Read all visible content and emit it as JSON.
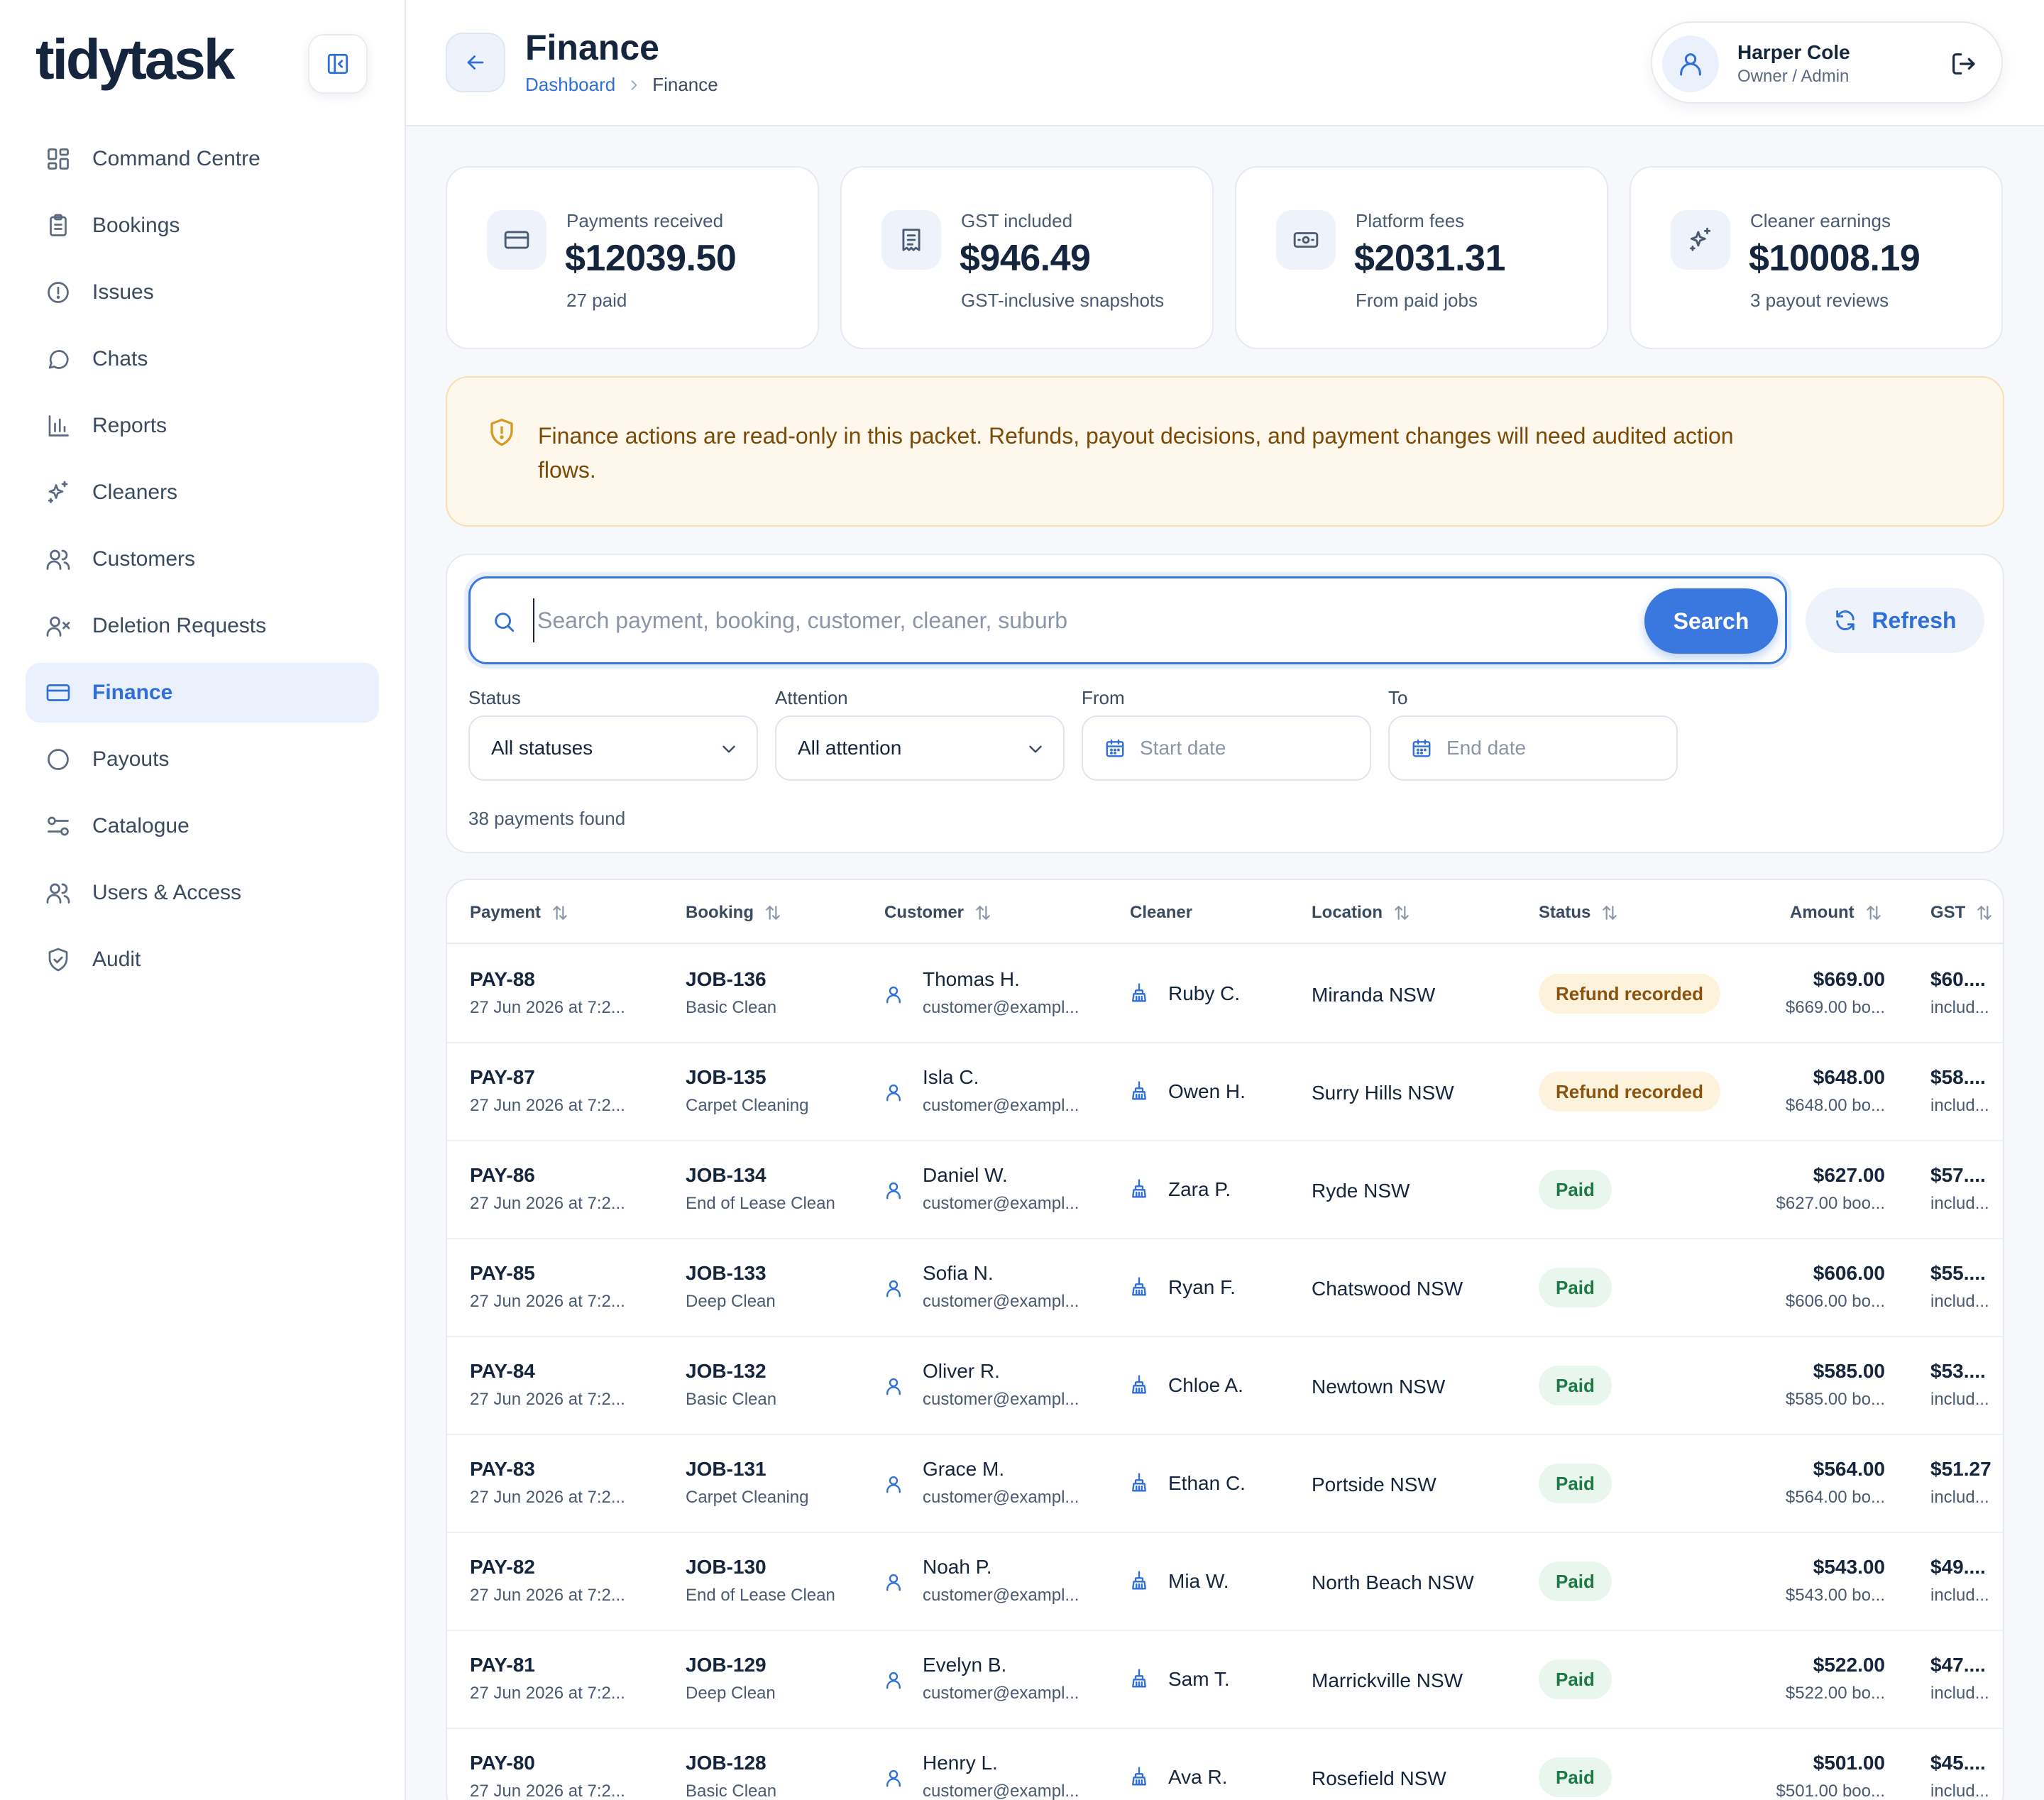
{
  "app": {
    "logo": "tidytask"
  },
  "sidebar": {
    "items": [
      {
        "label": "Command Centre",
        "icon": "grid-icon"
      },
      {
        "label": "Bookings",
        "icon": "clipboard-icon"
      },
      {
        "label": "Issues",
        "icon": "alert-circle-icon"
      },
      {
        "label": "Chats",
        "icon": "chat-bubble-icon"
      },
      {
        "label": "Reports",
        "icon": "bar-chart-icon"
      },
      {
        "label": "Cleaners",
        "icon": "sparkles-icon"
      },
      {
        "label": "Customers",
        "icon": "users-icon"
      },
      {
        "label": "Deletion Requests",
        "icon": "user-x-icon"
      },
      {
        "label": "Finance",
        "icon": "credit-card-icon",
        "active": true
      },
      {
        "label": "Payouts",
        "icon": "circle-icon"
      },
      {
        "label": "Catalogue",
        "icon": "sliders-icon"
      },
      {
        "label": "Users & Access",
        "icon": "users-icon"
      },
      {
        "label": "Audit",
        "icon": "shield-check-icon"
      }
    ]
  },
  "header": {
    "title": "Finance",
    "breadcrumb": {
      "link": "Dashboard",
      "current": "Finance"
    },
    "user": {
      "name": "Harper Cole",
      "role": "Owner / Admin"
    }
  },
  "stats": [
    {
      "label": "Payments received",
      "value": "$12039.50",
      "sub": "27 paid",
      "icon": "card-icon"
    },
    {
      "label": "GST included",
      "value": "$946.49",
      "sub": "GST-inclusive snapshots",
      "icon": "receipt-icon"
    },
    {
      "label": "Platform fees",
      "value": "$2031.31",
      "sub": "From paid jobs",
      "icon": "banknote-icon"
    },
    {
      "label": "Cleaner earnings",
      "value": "$10008.19",
      "sub": "3 payout reviews",
      "icon": "sparkles-icon"
    }
  ],
  "notice": {
    "text": "Finance actions are read-only in this packet. Refunds, payout decisions, and payment changes will need audited action flows."
  },
  "filters": {
    "search_placeholder": "Search payment, booking, customer, cleaner, suburb",
    "search_label": "Search",
    "refresh_label": "Refresh",
    "status": {
      "label": "Status",
      "value": "All statuses"
    },
    "attention": {
      "label": "Attention",
      "value": "All attention"
    },
    "from": {
      "label": "From",
      "placeholder": "Start date"
    },
    "to": {
      "label": "To",
      "placeholder": "End date"
    },
    "results": "38 payments found"
  },
  "table": {
    "columns": [
      "Payment",
      "Booking",
      "Customer",
      "Cleaner",
      "Location",
      "Status",
      "Amount",
      "GST"
    ],
    "rows": [
      {
        "payment": "PAY-88",
        "date": "27 Jun 2026 at 7:2...",
        "booking": "JOB-136",
        "service": "Basic Clean",
        "customer": "Thomas H.",
        "email": "customer@exampl...",
        "cleaner": "Ruby C.",
        "location": "Miranda NSW",
        "status": "Refund recorded",
        "status_type": "refund",
        "amount": "$669.00",
        "amount_sub": "$669.00 bo...",
        "gst": "$60....",
        "gst_sub": "includ..."
      },
      {
        "payment": "PAY-87",
        "date": "27 Jun 2026 at 7:2...",
        "booking": "JOB-135",
        "service": "Carpet Cleaning",
        "customer": "Isla C.",
        "email": "customer@exampl...",
        "cleaner": "Owen H.",
        "location": "Surry Hills NSW",
        "status": "Refund recorded",
        "status_type": "refund",
        "amount": "$648.00",
        "amount_sub": "$648.00 bo...",
        "gst": "$58....",
        "gst_sub": "includ..."
      },
      {
        "payment": "PAY-86",
        "date": "27 Jun 2026 at 7:2...",
        "booking": "JOB-134",
        "service": "End of Lease Clean",
        "customer": "Daniel W.",
        "email": "customer@exampl...",
        "cleaner": "Zara P.",
        "location": "Ryde NSW",
        "status": "Paid",
        "status_type": "paid",
        "amount": "$627.00",
        "amount_sub": "$627.00 boo...",
        "gst": "$57....",
        "gst_sub": "includ..."
      },
      {
        "payment": "PAY-85",
        "date": "27 Jun 2026 at 7:2...",
        "booking": "JOB-133",
        "service": "Deep Clean",
        "customer": "Sofia N.",
        "email": "customer@exampl...",
        "cleaner": "Ryan F.",
        "location": "Chatswood NSW",
        "status": "Paid",
        "status_type": "paid",
        "amount": "$606.00",
        "amount_sub": "$606.00 bo...",
        "gst": "$55....",
        "gst_sub": "includ..."
      },
      {
        "payment": "PAY-84",
        "date": "27 Jun 2026 at 7:2...",
        "booking": "JOB-132",
        "service": "Basic Clean",
        "customer": "Oliver R.",
        "email": "customer@exampl...",
        "cleaner": "Chloe A.",
        "location": "Newtown NSW",
        "status": "Paid",
        "status_type": "paid",
        "amount": "$585.00",
        "amount_sub": "$585.00 bo...",
        "gst": "$53....",
        "gst_sub": "includ..."
      },
      {
        "payment": "PAY-83",
        "date": "27 Jun 2026 at 7:2...",
        "booking": "JOB-131",
        "service": "Carpet Cleaning",
        "customer": "Grace M.",
        "email": "customer@exampl...",
        "cleaner": "Ethan C.",
        "location": "Portside NSW",
        "status": "Paid",
        "status_type": "paid",
        "amount": "$564.00",
        "amount_sub": "$564.00 bo...",
        "gst": "$51.27",
        "gst_sub": "includ..."
      },
      {
        "payment": "PAY-82",
        "date": "27 Jun 2026 at 7:2...",
        "booking": "JOB-130",
        "service": "End of Lease Clean",
        "customer": "Noah P.",
        "email": "customer@exampl...",
        "cleaner": "Mia W.",
        "location": "North Beach NSW",
        "status": "Paid",
        "status_type": "paid",
        "amount": "$543.00",
        "amount_sub": "$543.00 bo...",
        "gst": "$49....",
        "gst_sub": "includ..."
      },
      {
        "payment": "PAY-81",
        "date": "27 Jun 2026 at 7:2...",
        "booking": "JOB-129",
        "service": "Deep Clean",
        "customer": "Evelyn B.",
        "email": "customer@exampl...",
        "cleaner": "Sam T.",
        "location": "Marrickville NSW",
        "status": "Paid",
        "status_type": "paid",
        "amount": "$522.00",
        "amount_sub": "$522.00 bo...",
        "gst": "$47....",
        "gst_sub": "includ..."
      },
      {
        "payment": "PAY-80",
        "date": "27 Jun 2026 at 7:2...",
        "booking": "JOB-128",
        "service": "Basic Clean",
        "customer": "Henry L.",
        "email": "customer@exampl...",
        "cleaner": "Ava R.",
        "location": "Rosefield NSW",
        "status": "Paid",
        "status_type": "paid",
        "amount": "$501.00",
        "amount_sub": "$501.00 boo...",
        "gst": "$45....",
        "gst_sub": "includ..."
      }
    ]
  },
  "colors": {
    "accent": "#2f6fd6",
    "text": "#14253d",
    "notice_bg": "#fef8ec",
    "refund_badge": "#fdf2dc",
    "paid_badge": "#e8f6ee"
  }
}
